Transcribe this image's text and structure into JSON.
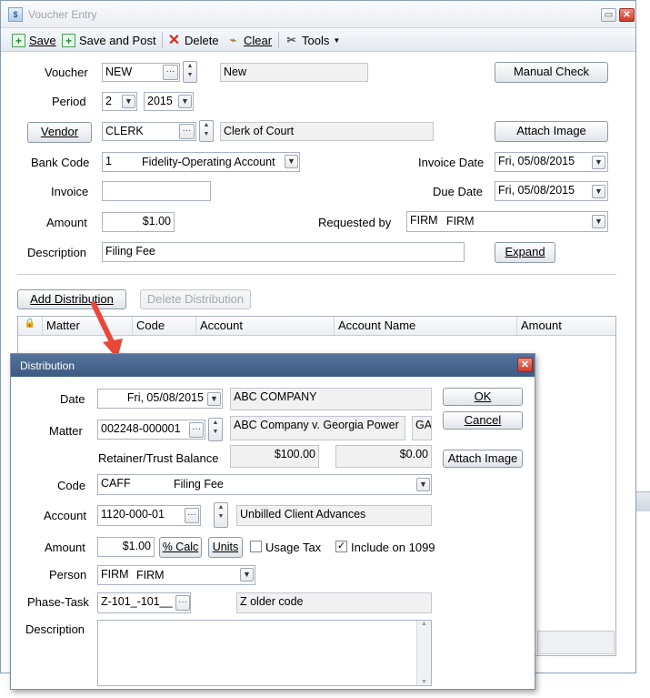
{
  "window": {
    "title": "Voucher Entry",
    "minimize": "▭",
    "close": "✕"
  },
  "toolbar": {
    "save": "Save",
    "save_and_post": "Save and Post",
    "delete": "Delete",
    "clear": "Clear",
    "tools": "Tools"
  },
  "form": {
    "voucher_label": "Voucher",
    "voucher_value": "NEW",
    "voucher_desc": "New",
    "period_label": "Period",
    "period_value": "2",
    "year_value": "2015",
    "vendor_button": "Vendor",
    "vendor_value": "CLERK",
    "vendor_name": "Clerk of Court",
    "bank_code_label": "Bank Code",
    "bank_code_value": "1",
    "bank_name": "Fidelity-Operating Account",
    "invoice_label": "Invoice",
    "invoice_value": "",
    "amount_label": "Amount",
    "amount_value": "$1.00",
    "description_label": "Description",
    "description_value": "Filing Fee",
    "invoice_date_label": "Invoice Date",
    "invoice_date_value": "Fri, 05/08/2015",
    "due_date_label": "Due Date",
    "due_date_value": "Fri, 05/08/2015",
    "requested_by_label": "Requested by",
    "requested_by_code": "FIRM",
    "requested_by_name": "FIRM",
    "manual_check": "Manual Check",
    "attach_image": "Attach Image",
    "expand": "Expand"
  },
  "distribution_actions": {
    "add": "Add Distribution",
    "delete": "Delete Distribution"
  },
  "grid": {
    "columns": [
      "Matter",
      "Code",
      "Account",
      "Account Name",
      "Amount"
    ]
  },
  "dialog": {
    "title": "Distribution",
    "date_label": "Date",
    "date_value": "Fri, 05/08/2015",
    "client_name": "ABC COMPANY",
    "matter_label": "Matter",
    "matter_value": "002248-000001",
    "matter_name": "ABC Company v. Georgia Power",
    "matter_extra": "GA",
    "retainer_label": "Retainer/Trust Balance",
    "retainer_value": "$100.00",
    "trust_value": "$0.00",
    "code_label": "Code",
    "code_value": "CAFF",
    "code_name": "Filing Fee",
    "account_label": "Account",
    "account_value": "1120-000-01",
    "account_name": "Unbilled Client Advances",
    "amount_label": "Amount",
    "amount_value": "$1.00",
    "pct_calc": "% Calc",
    "units": "Units",
    "usage_tax_label": "Usage Tax",
    "usage_tax_checked": false,
    "include_1099_label": "Include on 1099",
    "include_1099_checked": true,
    "person_label": "Person",
    "person_code": "FIRM",
    "person_name": "FIRM",
    "phase_task_label": "Phase-Task",
    "phase_task_value": "Z-101_-101__",
    "phase_task_desc": "Z older code",
    "description_label": "Description",
    "description_value": "",
    "ok": "OK",
    "cancel": "Cancel",
    "attach_image": "Attach Image"
  },
  "colors": {
    "dialog_title": "#4a6890",
    "arrow": "#e8483a",
    "close_red": "#cc3a2b"
  }
}
